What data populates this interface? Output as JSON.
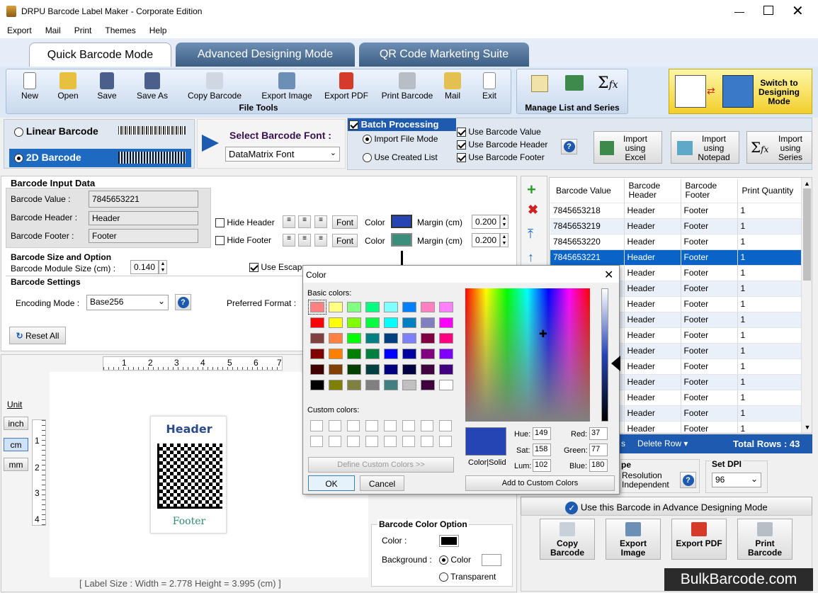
{
  "window": {
    "title": "DRPU Barcode Label Maker - Corporate Edition"
  },
  "menu": [
    "Export",
    "Mail",
    "Print",
    "Themes",
    "Help"
  ],
  "tabs": [
    "Quick Barcode Mode",
    "Advanced Designing Mode",
    "QR Code Marketing Suite"
  ],
  "file_tools": {
    "label": "File Tools",
    "buttons": [
      "New",
      "Open",
      "Save",
      "Save As",
      "Copy Barcode",
      "Export Image",
      "Export PDF",
      "Print Barcode",
      "Mail",
      "Exit"
    ]
  },
  "manage": {
    "label": "Manage List and Series"
  },
  "switch_mode": "Switch to Designing Mode",
  "barcode_type": {
    "linear": "Linear Barcode",
    "twod": "2D Barcode"
  },
  "font_select": {
    "label": "Select Barcode Font :",
    "value": "DataMatrix Font"
  },
  "batch": {
    "title": "Batch Processing",
    "import_file": "Import File Mode",
    "use_list": "Use Created List",
    "use_value": "Use Barcode Value",
    "use_header": "Use Barcode Header",
    "use_footer": "Use Barcode Footer"
  },
  "imports": [
    "Import using Excel",
    "Import using Notepad",
    "Import using Series"
  ],
  "input_data": {
    "title": "Barcode Input Data",
    "value_label": "Barcode Value :",
    "value": "7845653221",
    "header_label": "Barcode Header :",
    "header": "Header",
    "footer_label": "Barcode Footer :",
    "footer": "Footer",
    "hide_header": "Hide Header",
    "hide_footer": "Hide Footer",
    "font": "Font",
    "color": "Color",
    "margin": "Margin (cm)",
    "margin_header": "0.200",
    "margin_footer": "0.200"
  },
  "size_option": {
    "title": "Barcode Size and Option",
    "module_label": "Barcode Module Size (cm) :",
    "module": "0.140",
    "use_escape": "Use Escape Sequence (Barcode Value)"
  },
  "settings": {
    "title": "Barcode Settings",
    "encoding_label": "Encoding Mode :",
    "encoding": "Base256",
    "preferred": "Preferred Format :",
    "reset": "Reset All"
  },
  "units": {
    "label": "Unit",
    "items": [
      "inch",
      "cm",
      "mm"
    ]
  },
  "ruler_h": [
    "1",
    "2",
    "3",
    "4",
    "5",
    "6",
    "7"
  ],
  "ruler_v": [
    "1",
    "2",
    "3",
    "4"
  ],
  "label_preview": {
    "header": "Header",
    "footer": "Footer",
    "size": "[ Label Size : Width = 2.778  Height = 3.995 (cm) ]"
  },
  "color_option": {
    "title": "Barcode Color Option",
    "color": "Color :",
    "background": "Background :",
    "bg_color": "Color",
    "bg_transparent": "Transparent"
  },
  "table": {
    "headers": [
      "Barcode Value",
      "Barcode Header",
      "Barcode Footer",
      "Print Quantity"
    ],
    "rows": [
      [
        "7845653218",
        "Header",
        "Footer",
        "1"
      ],
      [
        "7845653219",
        "Header",
        "Footer",
        "1"
      ],
      [
        "7845653220",
        "Header",
        "Footer",
        "1"
      ],
      [
        "7845653221",
        "Header",
        "Footer",
        "1"
      ],
      [
        "",
        "Header",
        "Footer",
        "1"
      ],
      [
        "",
        "Header",
        "Footer",
        "1"
      ],
      [
        "",
        "Header",
        "Footer",
        "1"
      ],
      [
        "",
        "Header",
        "Footer",
        "1"
      ],
      [
        "",
        "Header",
        "Footer",
        "1"
      ],
      [
        "",
        "Header",
        "Footer",
        "1"
      ],
      [
        "",
        "Header",
        "Footer",
        "1"
      ],
      [
        "",
        "Header",
        "Footer",
        "1"
      ],
      [
        "",
        "Header",
        "Footer",
        "1"
      ],
      [
        "",
        "Header",
        "Footer",
        "1"
      ],
      [
        "",
        "Header",
        "Footer",
        "1"
      ]
    ],
    "selected_index": 3,
    "total": "Total Rows : 43",
    "delete_row": "Delete Row",
    "frag": "s"
  },
  "resolution": {
    "type_frag": "pe",
    "res": "Resolution Independent",
    "dpi_label": "Set DPI",
    "dpi": "96"
  },
  "advance": "Use this Barcode in Advance Designing Mode",
  "actions": [
    "Copy Barcode",
    "Export Image",
    "Export PDF",
    "Print Barcode"
  ],
  "watermark": "BulkBarcode.com",
  "color_dialog": {
    "title": "Color",
    "basic": "Basic colors:",
    "custom": "Custom colors:",
    "define": "Define Custom Colors >>",
    "ok": "OK",
    "cancel": "Cancel",
    "colorsolid": "Color|Solid",
    "add": "Add to Custom Colors",
    "hue_label": "Hue:",
    "hue": "149",
    "sat_label": "Sat:",
    "sat": "158",
    "lum_label": "Lum:",
    "lum": "102",
    "red_label": "Red:",
    "red": "37",
    "green_label": "Green:",
    "green": "77",
    "blue_label": "Blue:",
    "blue": "180",
    "basic_colors": [
      "#ff8080",
      "#ffff80",
      "#80ff80",
      "#00ff80",
      "#80ffff",
      "#0080ff",
      "#ff80c0",
      "#ff80ff",
      "#ff0000",
      "#ffff00",
      "#80ff00",
      "#00ff40",
      "#00ffff",
      "#0080c0",
      "#8080c0",
      "#ff00ff",
      "#804040",
      "#ff8040",
      "#00ff00",
      "#008080",
      "#004080",
      "#8080ff",
      "#800040",
      "#ff0080",
      "#800000",
      "#ff8000",
      "#008000",
      "#008040",
      "#0000ff",
      "#0000a0",
      "#800080",
      "#8000ff",
      "#400000",
      "#804000",
      "#004000",
      "#004040",
      "#000080",
      "#000040",
      "#400040",
      "#400080",
      "#000000",
      "#808000",
      "#808040",
      "#808080",
      "#408080",
      "#c0c0c0",
      "#400040",
      "#ffffff"
    ],
    "selected": "#2545b4"
  },
  "colors": {
    "accent": "#0a64c8",
    "header_text": "#2b4b8c",
    "footer_text": "#2e8b6e",
    "selected_color": "#2545b4",
    "footer_color": "#3a8f7a"
  }
}
